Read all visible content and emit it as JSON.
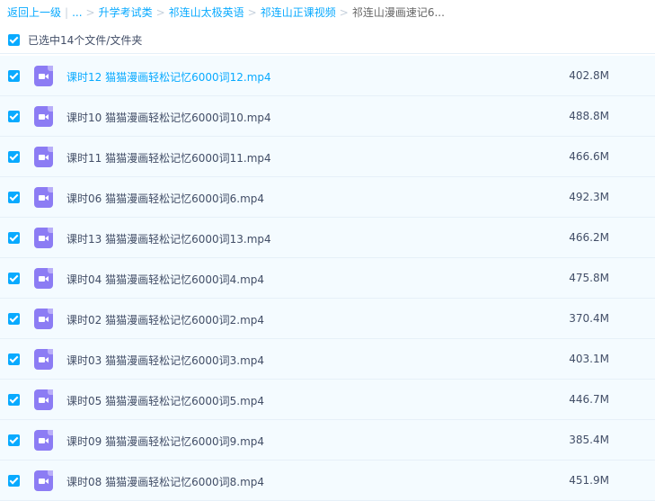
{
  "breadcrumb": {
    "back": "返回上一级",
    "ellipsis": "...",
    "items": [
      "升学考试类",
      "祁连山太极英语",
      "祁连山正课视频"
    ],
    "current": "祁连山漫画速记6..."
  },
  "selection": {
    "label": "已选中14个文件/文件夹"
  },
  "files": [
    {
      "name": "课时12 猫猫漫画轻松记忆6000词12.mp4",
      "size": "402.8M"
    },
    {
      "name": "课时10 猫猫漫画轻松记忆6000词10.mp4",
      "size": "488.8M"
    },
    {
      "name": "课时11 猫猫漫画轻松记忆6000词11.mp4",
      "size": "466.6M"
    },
    {
      "name": "课时06 猫猫漫画轻松记忆6000词6.mp4",
      "size": "492.3M"
    },
    {
      "name": "课时13 猫猫漫画轻松记忆6000词13.mp4",
      "size": "466.2M"
    },
    {
      "name": "课时04 猫猫漫画轻松记忆6000词4.mp4",
      "size": "475.8M"
    },
    {
      "name": "课时02 猫猫漫画轻松记忆6000词2.mp4",
      "size": "370.4M"
    },
    {
      "name": "课时03 猫猫漫画轻松记忆6000词3.mp4",
      "size": "403.1M"
    },
    {
      "name": "课时05 猫猫漫画轻松记忆6000词5.mp4",
      "size": "446.7M"
    },
    {
      "name": "课时09 猫猫漫画轻松记忆6000词9.mp4",
      "size": "385.4M"
    },
    {
      "name": "课时08 猫猫漫画轻松记忆6000词8.mp4",
      "size": "451.9M"
    }
  ],
  "icons": {
    "file": "video-file-icon",
    "check": "checkbox-checked-icon"
  },
  "colors": {
    "accent": "#09aaff",
    "video_icon": "#8c7cf4",
    "row_bg": "#f4fbff"
  }
}
